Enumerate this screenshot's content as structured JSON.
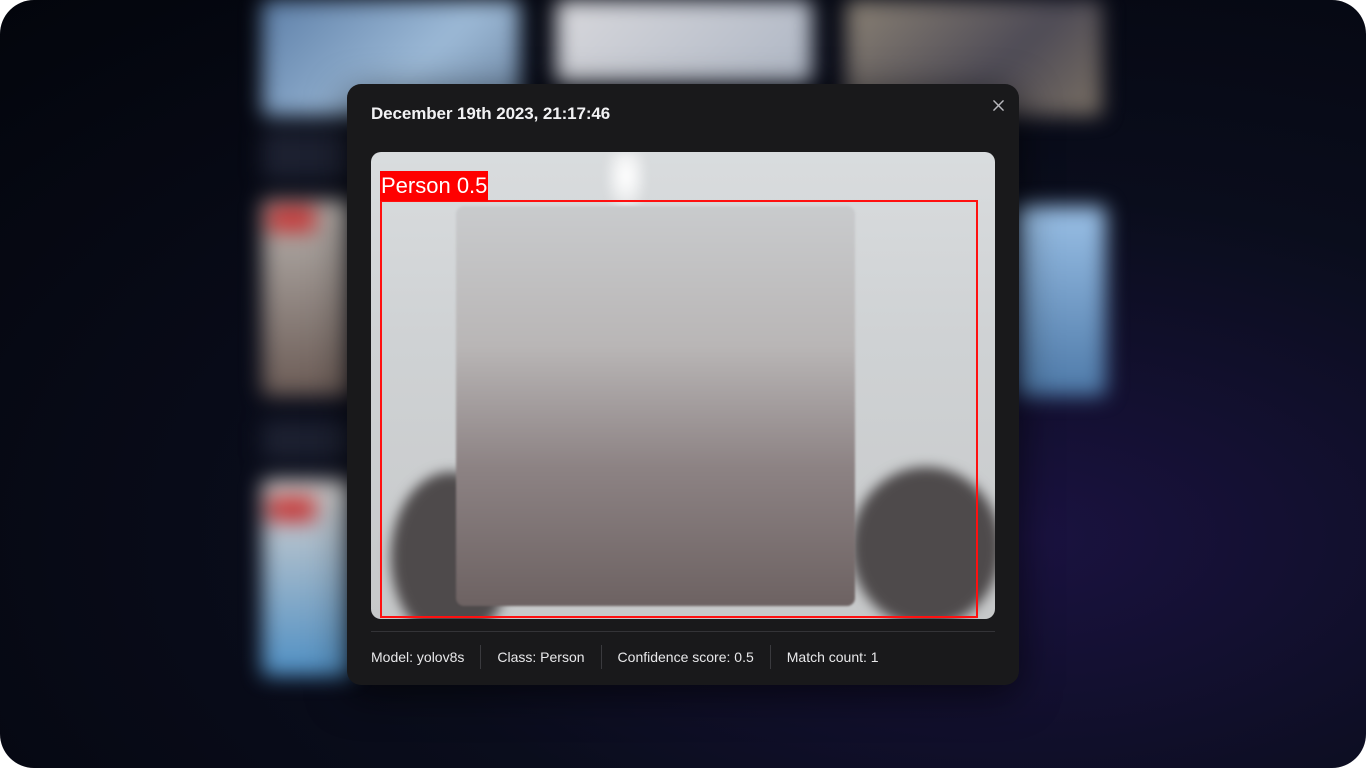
{
  "modal": {
    "title": "December 19th 2023, 21:17:46",
    "close_icon": "close-icon",
    "detection": {
      "label": "Person 0.5"
    },
    "info": {
      "model": "Model: yolov8s",
      "class": "Class: Person",
      "confidence": "Confidence score: 0.5",
      "match_count": "Match count: 1"
    }
  },
  "colors": {
    "modal_bg": "#19191b",
    "bbox": "#ff0000"
  }
}
